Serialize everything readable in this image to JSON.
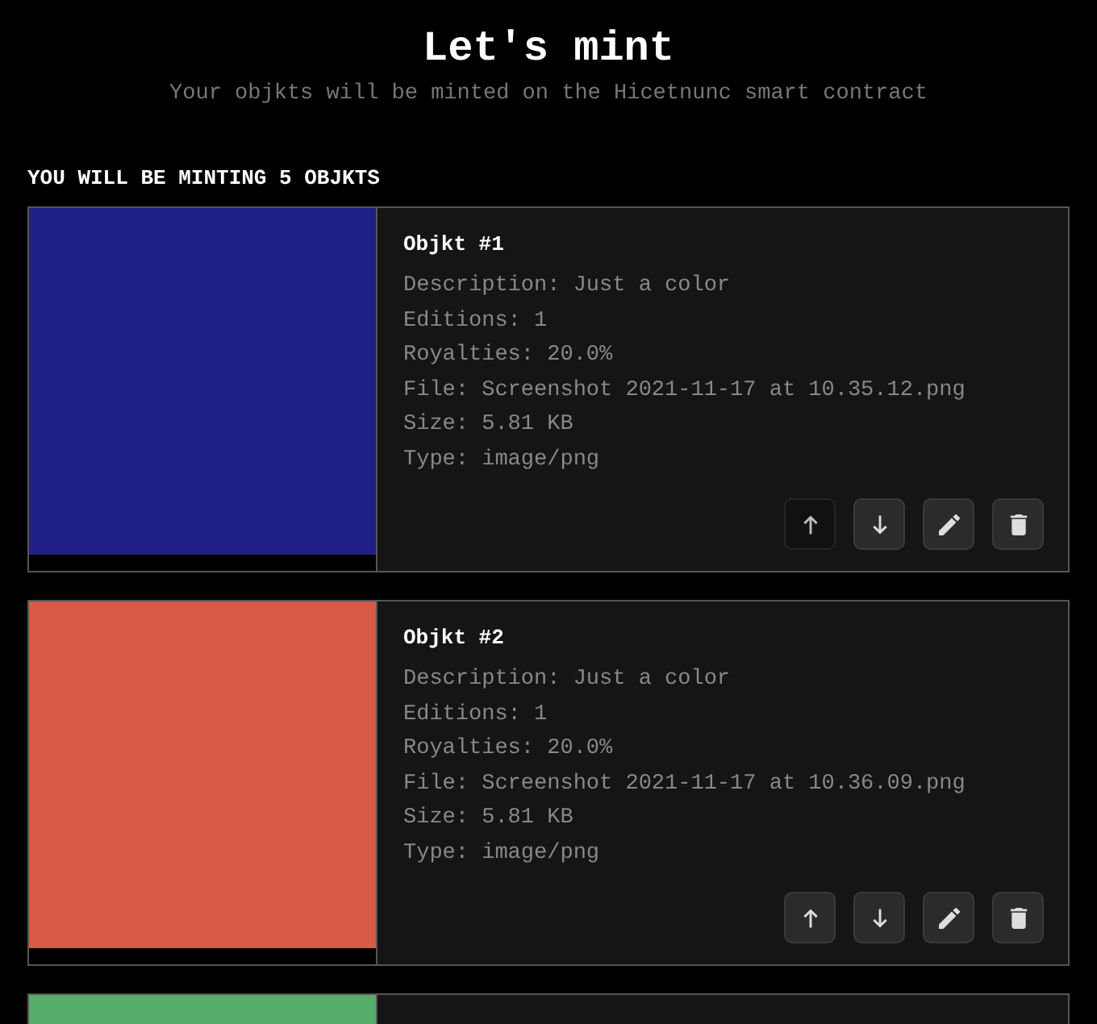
{
  "header": {
    "title": "Let's mint",
    "subtitle": "Your objkts will be minted on the Hicetnunc smart contract"
  },
  "section_heading": "YOU WILL BE MINTING 5 OBJKTS",
  "objkts": [
    {
      "color": "#1f1f86",
      "title": "Objkt #1",
      "details": [
        "Description: Just a color",
        "Editions: 1",
        "Royalties: 20.0%",
        "File: Screenshot 2021-11-17 at 10.35.12.png",
        "Size: 5.81 KB",
        "Type: image/png"
      ],
      "buttons": [
        {
          "kind": "up",
          "disabled": true
        },
        {
          "kind": "down",
          "disabled": false
        },
        {
          "kind": "edit",
          "disabled": false
        },
        {
          "kind": "delete",
          "disabled": false
        }
      ]
    },
    {
      "color": "#d95a47",
      "title": "Objkt #2",
      "details": [
        "Description: Just a color",
        "Editions: 1",
        "Royalties: 20.0%",
        "File: Screenshot 2021-11-17 at 10.36.09.png",
        "Size: 5.81 KB",
        "Type: image/png"
      ],
      "buttons": [
        {
          "kind": "up",
          "disabled": false
        },
        {
          "kind": "down",
          "disabled": false
        },
        {
          "kind": "edit",
          "disabled": false
        },
        {
          "kind": "delete",
          "disabled": false
        }
      ]
    },
    {
      "color": "#55ad6a"
    }
  ]
}
